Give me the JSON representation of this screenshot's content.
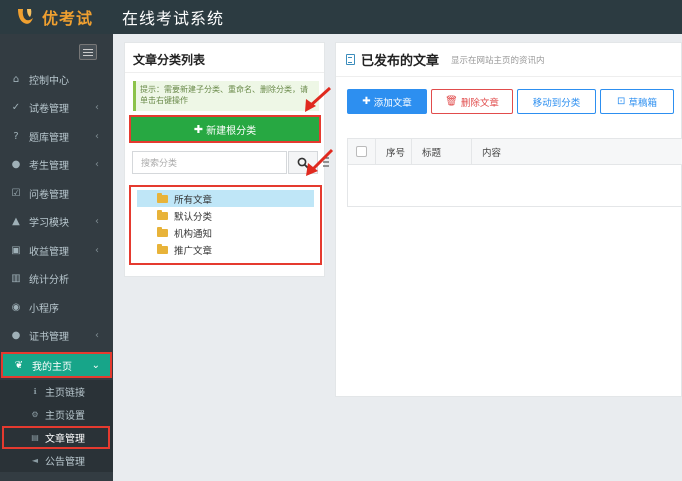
{
  "topbar": {
    "logo_text": "优考试",
    "system_title": "在线考试系统"
  },
  "sidebar": {
    "items": [
      {
        "label": "控制中心",
        "icon": "home-icon",
        "has_arrow": false
      },
      {
        "label": "试卷管理",
        "icon": "check-circle-icon",
        "has_arrow": true
      },
      {
        "label": "题库管理",
        "icon": "question-circle-icon",
        "has_arrow": true
      },
      {
        "label": "考生管理",
        "icon": "user-icon",
        "has_arrow": true
      },
      {
        "label": "问卷管理",
        "icon": "check-square-icon",
        "has_arrow": false
      },
      {
        "label": "学习模块",
        "icon": "graduation-cap-icon",
        "has_arrow": true
      },
      {
        "label": "收益管理",
        "icon": "money-icon",
        "has_arrow": true
      },
      {
        "label": "统计分析",
        "icon": "bar-chart-icon",
        "has_arrow": false
      },
      {
        "label": "小程序",
        "icon": "wechat-icon",
        "has_arrow": false
      },
      {
        "label": "证书管理",
        "icon": "certificate-icon",
        "has_arrow": true
      }
    ],
    "active_item": {
      "label": "我的主页",
      "icon": "leaf-icon"
    },
    "sub_items": [
      {
        "label": "主页链接",
        "icon": "info-icon"
      },
      {
        "label": "主页设置",
        "icon": "settings-icon"
      },
      {
        "label": "文章管理",
        "icon": "file-icon"
      },
      {
        "label": "公告管理",
        "icon": "bullhorn-icon"
      }
    ]
  },
  "category_panel": {
    "title": "文章分类列表",
    "tip": "提示：需要新建子分类、重命名、删除分类，请单击右键操作",
    "new_root_button": "新建根分类",
    "search_placeholder": "搜索分类",
    "tree": [
      {
        "label": "所有文章",
        "selected": true
      },
      {
        "label": "默认分类",
        "selected": false
      },
      {
        "label": "机构通知",
        "selected": false
      },
      {
        "label": "推广文章",
        "selected": false
      }
    ]
  },
  "article_panel": {
    "title": "已发布的文章",
    "subtitle": "显示在网站主页的资讯内",
    "buttons": {
      "add": "添加文章",
      "delete": "删除文章",
      "move": "移动到分类",
      "draft": "草稿箱"
    },
    "columns": [
      "序号",
      "标题",
      "内容"
    ]
  },
  "colors": {
    "topbar": "#2c3b41",
    "sidebar": "#333c42",
    "active_menu": "#17a589",
    "highlight_border": "#e53a2f",
    "primary": "#2d8ff0",
    "success": "#27a842",
    "danger": "#e14c4c"
  }
}
